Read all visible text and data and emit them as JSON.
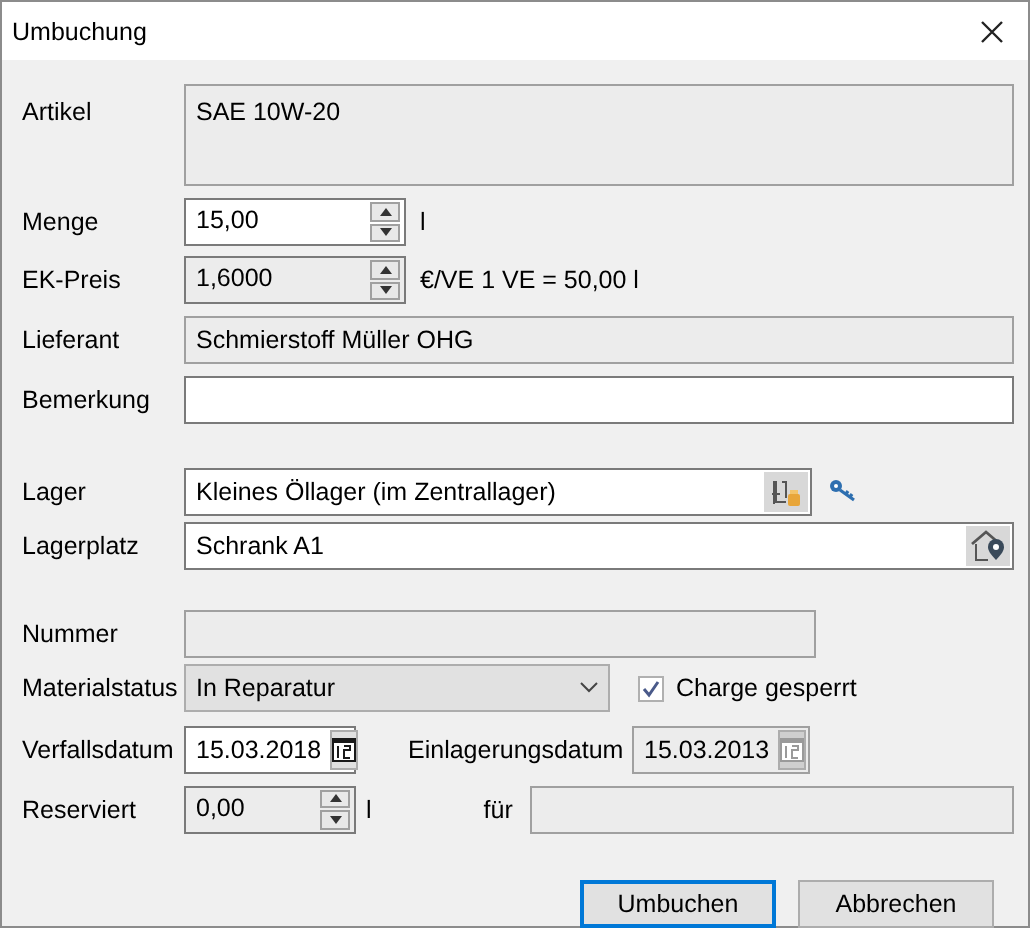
{
  "window": {
    "title": "Umbuchung"
  },
  "artikel": {
    "label": "Artikel",
    "value": "SAE 10W-20",
    "disabled": true
  },
  "menge": {
    "label": "Menge",
    "value": "15,00",
    "disabled": false,
    "unit": "l"
  },
  "ek_preis": {
    "label": "EK-Preis",
    "value": "1,6000",
    "disabled": true,
    "unit": "€/VE  1 VE = 50,00 l"
  },
  "lieferant": {
    "label": "Lieferant",
    "value": "Schmierstoff Müller OHG",
    "disabled": true
  },
  "bemerkung": {
    "label": "Bemerkung",
    "disabled": false
  },
  "lager": {
    "label": "Lager",
    "value": "Kleines Öllager (im Zentrallager)",
    "disabled": false
  },
  "lagerplatz": {
    "label": "Lagerplatz",
    "value": "Schrank A1",
    "disabled": false
  },
  "nummer": {
    "label": "Nummer",
    "disabled": true
  },
  "materialstatus": {
    "label": "Materialstatus",
    "value": "In Reparatur"
  },
  "charge_gesperrt": {
    "label": "Charge gesperrt",
    "checked": true
  },
  "verfallsdatum": {
    "label": "Verfallsdatum",
    "value": "15.03.2018",
    "disabled": false
  },
  "einlagerungsdatum": {
    "label": "Einlagerungsdatum",
    "value": "15.03.2013",
    "disabled": true
  },
  "reserviert": {
    "label": "Reserviert",
    "value": "0,00",
    "disabled": true,
    "unit": "l"
  },
  "fuer": {
    "label": "für",
    "disabled": true
  },
  "buttons": [
    {
      "label": "Umbuchen",
      "default": true
    },
    {
      "label": "Abbrechen",
      "default": false
    }
  ]
}
